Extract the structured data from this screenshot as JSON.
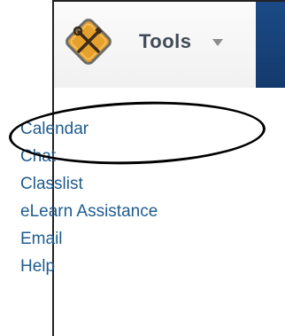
{
  "header": {
    "title": "Tools",
    "logo_icon": "tools-crossed-icon",
    "caret_icon": "caret-down-icon"
  },
  "menu": {
    "items": [
      {
        "label": "Calendar"
      },
      {
        "label": "Chat"
      },
      {
        "label": "Classlist"
      },
      {
        "label": "eLearn Assistance"
      },
      {
        "label": "Email"
      },
      {
        "label": "Help"
      }
    ]
  },
  "annotation": {
    "highlighted_item": "Calendar"
  },
  "colors": {
    "link": "#1f5b8f",
    "header_accent": "#1b4a86",
    "logo_fill": "#e5a12b",
    "label": "#404a56"
  }
}
